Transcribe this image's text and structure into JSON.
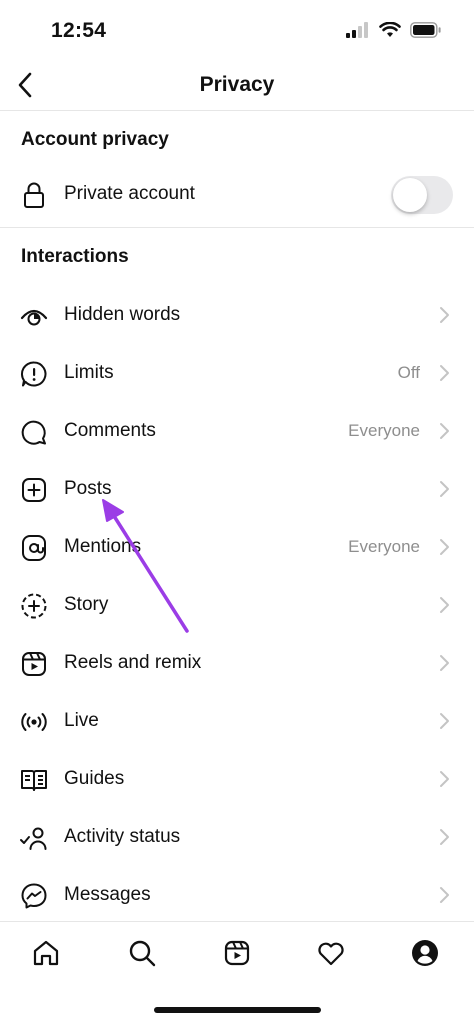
{
  "status_bar": {
    "time": "12:54"
  },
  "nav": {
    "title": "Privacy"
  },
  "sections": {
    "account_privacy": "Account privacy",
    "interactions": "Interactions"
  },
  "private_account": {
    "label": "Private account",
    "enabled": false
  },
  "items": [
    {
      "label": "Hidden words",
      "value": "",
      "icon": "eye-icon"
    },
    {
      "label": "Limits",
      "value": "Off",
      "icon": "limits-icon"
    },
    {
      "label": "Comments",
      "value": "Everyone",
      "icon": "comment-icon"
    },
    {
      "label": "Posts",
      "value": "",
      "icon": "plus-square-icon"
    },
    {
      "label": "Mentions",
      "value": "Everyone",
      "icon": "at-icon"
    },
    {
      "label": "Story",
      "value": "",
      "icon": "story-icon"
    },
    {
      "label": "Reels and remix",
      "value": "",
      "icon": "reels-icon"
    },
    {
      "label": "Live",
      "value": "",
      "icon": "live-icon"
    },
    {
      "label": "Guides",
      "value": "",
      "icon": "guides-icon"
    },
    {
      "label": "Activity status",
      "value": "",
      "icon": "activity-status-icon"
    },
    {
      "label": "Messages",
      "value": "",
      "icon": "messenger-icon"
    }
  ],
  "tab_bar": [
    "home-icon",
    "search-icon",
    "reels-icon",
    "heart-icon",
    "profile-icon"
  ],
  "colors": {
    "annotation_arrow": "#9b3de6",
    "secondary_text": "#8e8e8e",
    "toggle_off": "#e9e9eb"
  }
}
